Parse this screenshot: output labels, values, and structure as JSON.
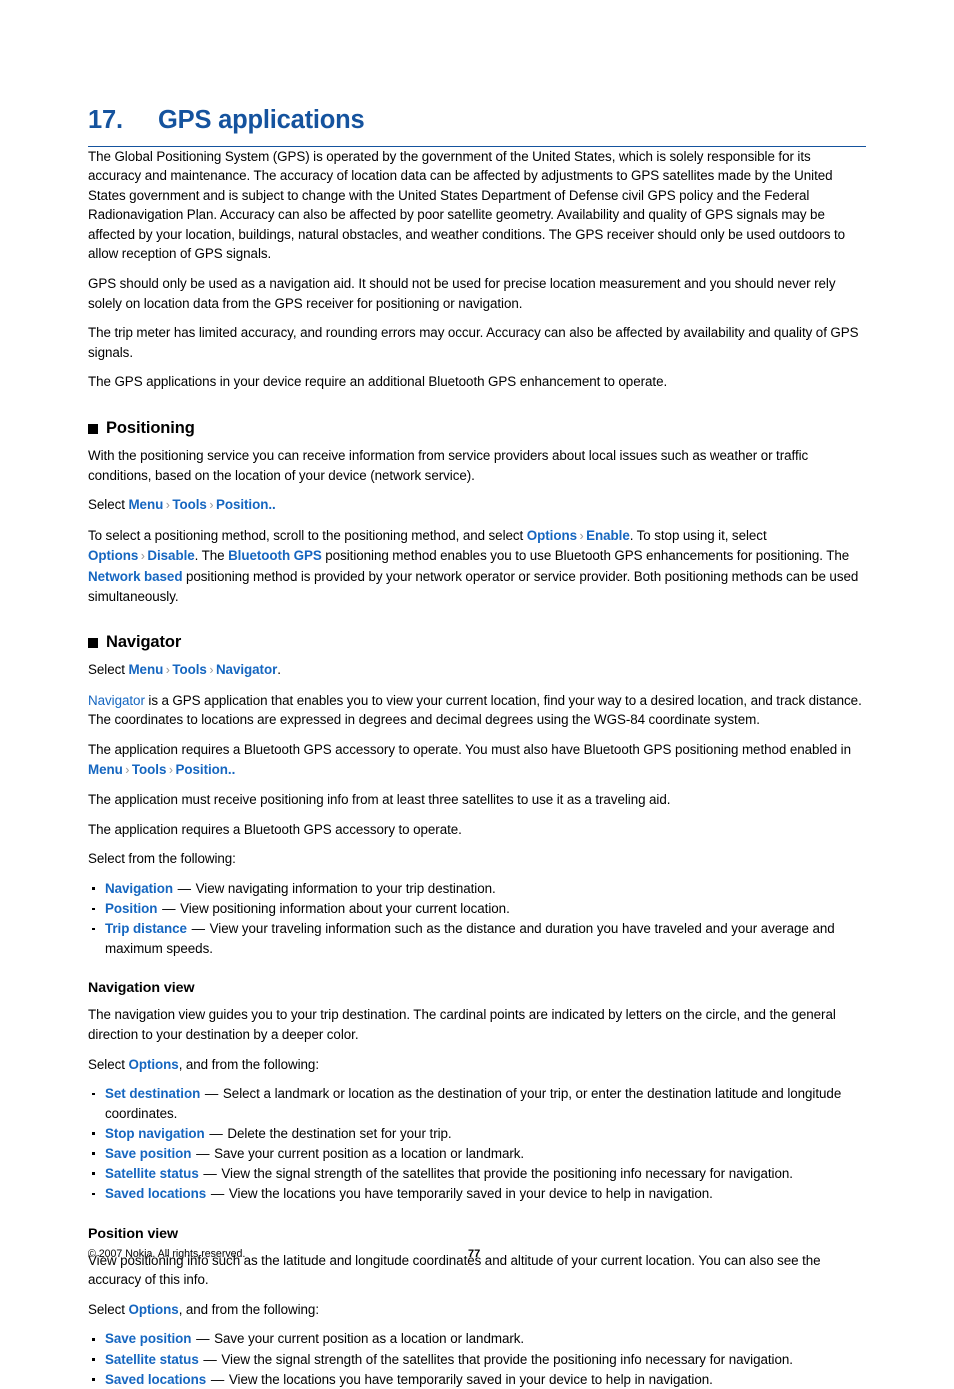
{
  "chapter": {
    "number": "17.",
    "title": "GPS applications"
  },
  "intro": {
    "p1": "The Global Positioning System (GPS) is operated by the government of the United States, which is solely responsible for its accuracy and maintenance. The accuracy of location data can be affected by adjustments to GPS satellites made by the United States government and is subject to change with the United States Department of Defense civil GPS policy and the Federal Radionavigation Plan. Accuracy can also be affected by poor satellite geometry. Availability and quality of GPS signals may be affected by your location, buildings, natural obstacles, and weather conditions. The GPS receiver should only be used outdoors to allow reception of GPS signals.",
    "p2": "GPS should only be used as a navigation aid. It should not be used for precise location measurement and you should never rely solely on location data from the GPS receiver for positioning or navigation.",
    "p3": "The trip meter has limited accuracy, and rounding errors may occur. Accuracy can also be affected by availability and quality of GPS signals.",
    "p4": "The GPS applications in your device require an additional Bluetooth GPS enhancement to operate."
  },
  "positioning": {
    "heading": "Positioning",
    "p1": "With the positioning service you can receive information from service providers about local issues such as weather or traffic conditions, based on the location of your device (network service).",
    "select_label": "Select",
    "path": {
      "menu": "Menu",
      "tools": "Tools",
      "position": "Position..",
      "chevron": "›"
    },
    "method": {
      "t1": "To select a positioning method, scroll to the positioning method, and select",
      "options1": "Options",
      "enable": "Enable",
      "t2": ". To stop using it, select",
      "options2": "Options",
      "disable": "Disable",
      "t3": ". The",
      "bluetooth_gps": "Bluetooth GPS",
      "t4": "positioning method enables you to use Bluetooth GPS enhancements for positioning. The",
      "network_based": "Network based",
      "t5": "positioning method is provided by your network operator or service provider. Both positioning methods can be used simultaneously."
    }
  },
  "navigator": {
    "heading": "Navigator",
    "select_label": "Select",
    "path": {
      "menu": "Menu",
      "tools": "Tools",
      "navigator": "Navigator",
      "period": "."
    },
    "p_desc_link": "Navigator",
    "p_desc_rest": "is a GPS application that enables you to view your current location, find your way to a desired location, and track distance. The coordinates to locations are expressed in degrees and decimal degrees using the WGS-84 coordinate system.",
    "p_req_1": "The application requires a Bluetooth GPS accessory to operate. You must also have Bluetooth GPS positioning method enabled in",
    "path2": {
      "menu": "Menu",
      "tools": "Tools",
      "position": "Position.."
    },
    "p_sat": "The application must receive positioning info from at least three satellites to use it as a traveling aid.",
    "p_req_2": "The application requires a Bluetooth GPS accessory to operate.",
    "select_following": "Select from the following:",
    "items": [
      {
        "label": "Navigation",
        "desc": "View navigating information to your trip destination."
      },
      {
        "label": "Position",
        "desc": "View positioning information about your current location."
      },
      {
        "label": "Trip distance",
        "desc": "View your traveling information such as the distance and duration you have traveled and your average and maximum speeds."
      }
    ]
  },
  "navigation_view": {
    "heading": "Navigation view",
    "p1": "The navigation view guides you to your trip destination. The cardinal points are indicated by letters on the circle, and the general direction to your destination by a deeper color.",
    "select_prefix": "Select",
    "options_label": "Options",
    "select_suffix": ", and from the following:",
    "items": [
      {
        "label": "Set destination",
        "desc": "Select a landmark or location as the destination of your trip, or enter the destination latitude and longitude coordinates."
      },
      {
        "label": "Stop navigation",
        "desc": "Delete the destination set for your trip."
      },
      {
        "label": "Save position",
        "desc": "Save your current position as a location or landmark."
      },
      {
        "label": "Satellite status",
        "desc": "View the signal strength of the satellites that provide the positioning info necessary for navigation."
      },
      {
        "label": "Saved locations",
        "desc": "View the locations you have temporarily saved in your device to help in navigation."
      }
    ]
  },
  "position_view": {
    "heading": "Position view",
    "p1": "View positioning info such as the latitude and longitude coordinates and altitude of your current location. You can also see the accuracy of this info.",
    "select_prefix": "Select",
    "options_label": "Options",
    "select_suffix": ", and from the following:",
    "items": [
      {
        "label": "Save position",
        "desc": "Save your current position as a location or landmark."
      },
      {
        "label": "Satellite status",
        "desc": "View the signal strength of the satellites that provide the positioning info necessary for navigation."
      },
      {
        "label": "Saved locations",
        "desc": "View the locations you have temporarily saved in your device to help in navigation."
      }
    ]
  },
  "footer": {
    "copyright": "© 2007 Nokia. All rights reserved.",
    "page_number": "77"
  },
  "colors": {
    "heading_blue": "#15539E",
    "link_blue": "#1566C0",
    "chevron_grey": "#9a9a9a"
  },
  "em_dash": "—"
}
